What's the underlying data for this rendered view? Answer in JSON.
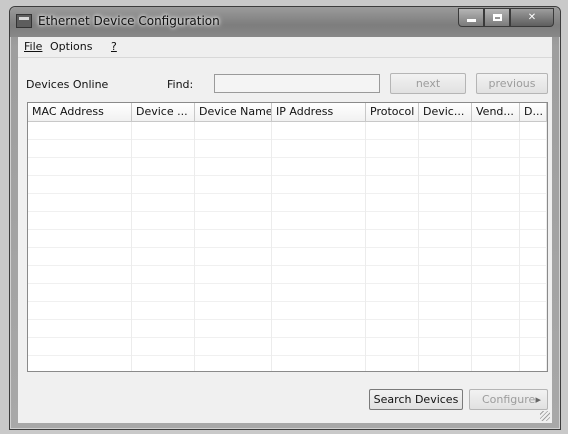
{
  "window": {
    "title": "Ethernet Device Configuration"
  },
  "menu": {
    "items": [
      {
        "label": "File"
      },
      {
        "label": "Options"
      },
      {
        "label": "?"
      }
    ]
  },
  "toolbar": {
    "devices_online_label": "Devices Online",
    "find_label": "Find:",
    "find_value": "",
    "next_label": "next",
    "previous_label": "previous"
  },
  "list": {
    "columns": [
      {
        "label": "MAC Address"
      },
      {
        "label": "Device ..."
      },
      {
        "label": "Device Name"
      },
      {
        "label": "IP Address"
      },
      {
        "label": "Protocol"
      },
      {
        "label": "Devic..."
      },
      {
        "label": "Vend..."
      },
      {
        "label": "D..."
      }
    ],
    "rows": []
  },
  "actions": {
    "search_label": "Search Devices",
    "configure_label": "Configure",
    "configure_arrow": "▸"
  },
  "icons": {
    "app": "network-config-icon",
    "minimize": "minimize-icon",
    "maximize": "maximize-icon",
    "close": "close-icon"
  }
}
